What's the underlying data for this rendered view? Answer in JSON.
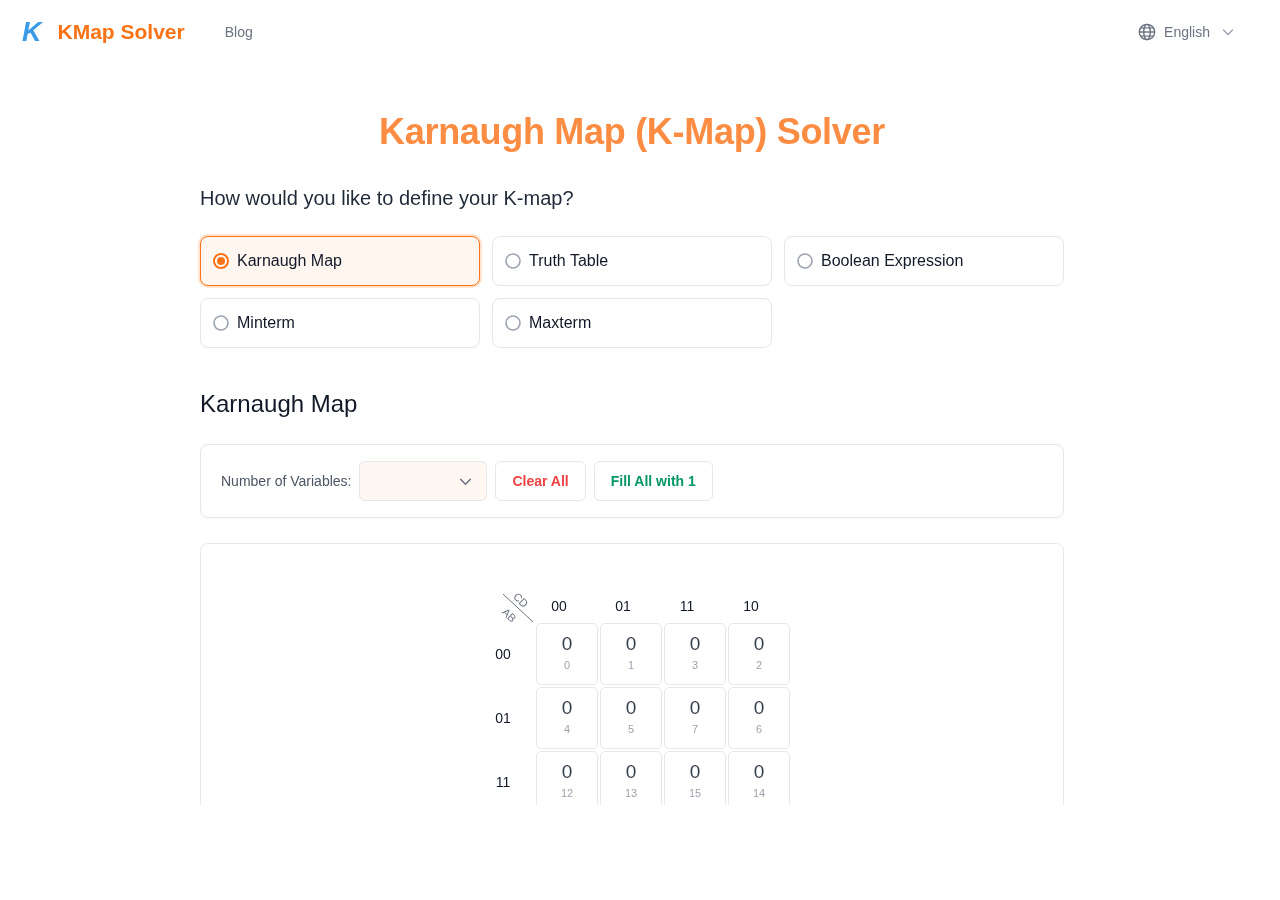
{
  "header": {
    "logo": "K",
    "brand": "KMap Solver",
    "nav": [
      {
        "label": "Blog"
      }
    ],
    "language": "English"
  },
  "title": "Karnaugh Map (K-Map) Solver",
  "question": "How would you like to define your K-map?",
  "input_modes": [
    {
      "label": "Karnaugh Map",
      "selected": true
    },
    {
      "label": "Truth Table",
      "selected": false
    },
    {
      "label": "Boolean Expression",
      "selected": false
    },
    {
      "label": "Minterm",
      "selected": false
    },
    {
      "label": "Maxterm",
      "selected": false
    }
  ],
  "section_title": "Karnaugh Map",
  "controls": {
    "variables_label": "Number of Variables:",
    "buttons": [
      {
        "label": "Clear All",
        "kind": "danger"
      },
      {
        "label": "Fill All with 1",
        "kind": "success"
      }
    ]
  },
  "kmap": {
    "column_variables": "CD",
    "row_variables": "AB",
    "columns": [
      "00",
      "01",
      "11",
      "10"
    ],
    "rows": [
      {
        "label": "00",
        "cells": [
          {
            "value": "0",
            "index": "0"
          },
          {
            "value": "0",
            "index": "1"
          },
          {
            "value": "0",
            "index": "3"
          },
          {
            "value": "0",
            "index": "2"
          }
        ]
      },
      {
        "label": "01",
        "cells": [
          {
            "value": "0",
            "index": "4"
          },
          {
            "value": "0",
            "index": "5"
          },
          {
            "value": "0",
            "index": "7"
          },
          {
            "value": "0",
            "index": "6"
          }
        ]
      },
      {
        "label": "11",
        "cells": [
          {
            "value": "0",
            "index": "12"
          },
          {
            "value": "0",
            "index": "13"
          },
          {
            "value": "0",
            "index": "15"
          },
          {
            "value": "0",
            "index": "14"
          }
        ]
      }
    ]
  }
}
